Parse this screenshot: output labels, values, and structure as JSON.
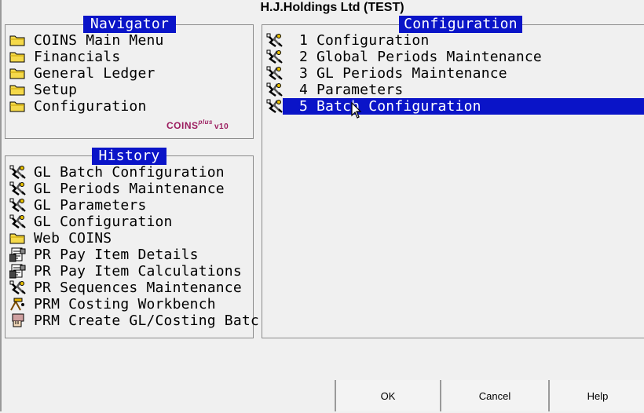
{
  "window": {
    "title": "H.J.Holdings Ltd (TEST)"
  },
  "navigator": {
    "title": "Navigator",
    "items": [
      {
        "label": "COINS Main Menu",
        "icon": "folder-icon"
      },
      {
        "label": "Financials",
        "icon": "folder-icon"
      },
      {
        "label": "General Ledger",
        "icon": "folder-icon"
      },
      {
        "label": "Setup",
        "icon": "folder-icon"
      },
      {
        "label": "Configuration",
        "icon": "folder-icon"
      }
    ],
    "logo": {
      "brand": "COINS",
      "plus": "plus",
      "version": "v10"
    }
  },
  "history": {
    "title": "History",
    "items": [
      {
        "label": "GL Batch Configuration",
        "icon": "tools-icon"
      },
      {
        "label": "GL Periods Maintenance",
        "icon": "tools-icon"
      },
      {
        "label": "GL Parameters",
        "icon": "tools-icon"
      },
      {
        "label": "GL Configuration",
        "icon": "tools-icon"
      },
      {
        "label": "Web COINS",
        "icon": "folder-icon"
      },
      {
        "label": "PR Pay Item Details",
        "icon": "form-icon"
      },
      {
        "label": "PR Pay Item Calculations",
        "icon": "form-icon"
      },
      {
        "label": "PR Sequences Maintenance",
        "icon": "tools-icon"
      },
      {
        "label": "PRM Costing Workbench",
        "icon": "workbench-icon"
      },
      {
        "label": "PRM Create GL/Costing Batc",
        "icon": "hand-icon"
      }
    ]
  },
  "configuration": {
    "title": "Configuration",
    "selected_index": 4,
    "items": [
      {
        "number": "1",
        "label": "Configuration"
      },
      {
        "number": "2",
        "label": "Global Periods Maintenance"
      },
      {
        "number": "3",
        "label": "GL Periods Maintenance"
      },
      {
        "number": "4",
        "label": "Parameters"
      },
      {
        "number": "5",
        "label": "Batch Configuration"
      }
    ]
  },
  "buttons": {
    "ok": "OK",
    "cancel": "Cancel",
    "help": "Help"
  },
  "colors": {
    "selection": "#0a14c8",
    "panel_title_bg": "#0a14c8",
    "logo": "#9b1b5e",
    "folder": "#f5d94a"
  }
}
